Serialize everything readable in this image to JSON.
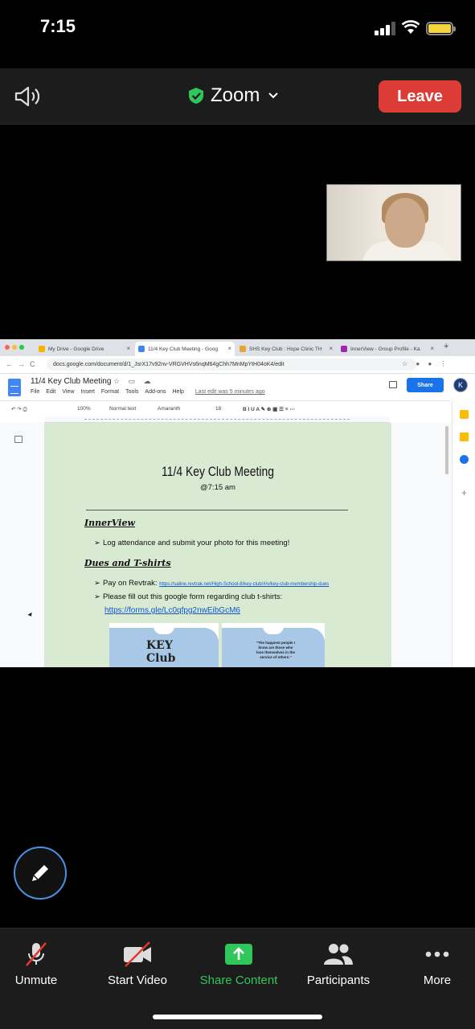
{
  "status_bar": {
    "time": "7:15"
  },
  "zoom_header": {
    "title": "Zoom",
    "leave_label": "Leave"
  },
  "browser": {
    "tabs": [
      {
        "title": "My Drive - Google Drive",
        "fav_color": "#f4b400"
      },
      {
        "title": "11/4 Key Club Meeting - Goog",
        "fav_color": "#4285f4"
      },
      {
        "title": "SHS Key Club : Hope Clinic TH",
        "fav_color": "#e8a33a"
      },
      {
        "title": "InnerView - Group Profile - Ka",
        "fav_color": "#9c27b0"
      }
    ],
    "url": "docs.google.com/document/d/1_JsrX17v92nv-VRGVHVs6nqM64gChh7MnMpYtH04oK4/edit"
  },
  "docs": {
    "title": "11/4 Key Club Meeting",
    "menus": [
      "File",
      "Edit",
      "View",
      "Insert",
      "Format",
      "Tools",
      "Add-ons",
      "Help"
    ],
    "last_edit": "Last edit was 5 minutes ago",
    "share_label": "Share",
    "avatar_letter": "K",
    "toolbar": {
      "zoom": "100%",
      "style": "Normal text",
      "font": "Amaranth",
      "size": "18"
    }
  },
  "document": {
    "heading": "11/4 Key Club Meeting",
    "subheading": "@7:15 am",
    "section1": "InnerView",
    "bullet1": "Log attendance and submit your photo for this meeting!",
    "section2": "Dues and T-shirts",
    "bullet2_prefix": "Pay on Revtrak:",
    "bullet2_link": "https://saline.revtrak.net/High-School-8/key-club/#/v/key-club-membership-dues",
    "bullet3": "Please fill out this google form regarding club t-shirts:",
    "form_link": "https://forms.gle/Lc0qfpg2nwEibGcM6",
    "shirt_front_text": "KEY Club",
    "shirt_back_quote": "\"The happiest people I know are those who lose themselves in the service of others.\""
  },
  "bottom_bar": {
    "unmute": "Unmute",
    "start_video": "Start Video",
    "share_content": "Share Content",
    "participants": "Participants",
    "more": "More"
  },
  "colors": {
    "leave": "#dd3b35",
    "share_green": "#2fc65b",
    "doc_bg": "#d9ead3",
    "annotate_ring": "#4a90e2"
  }
}
